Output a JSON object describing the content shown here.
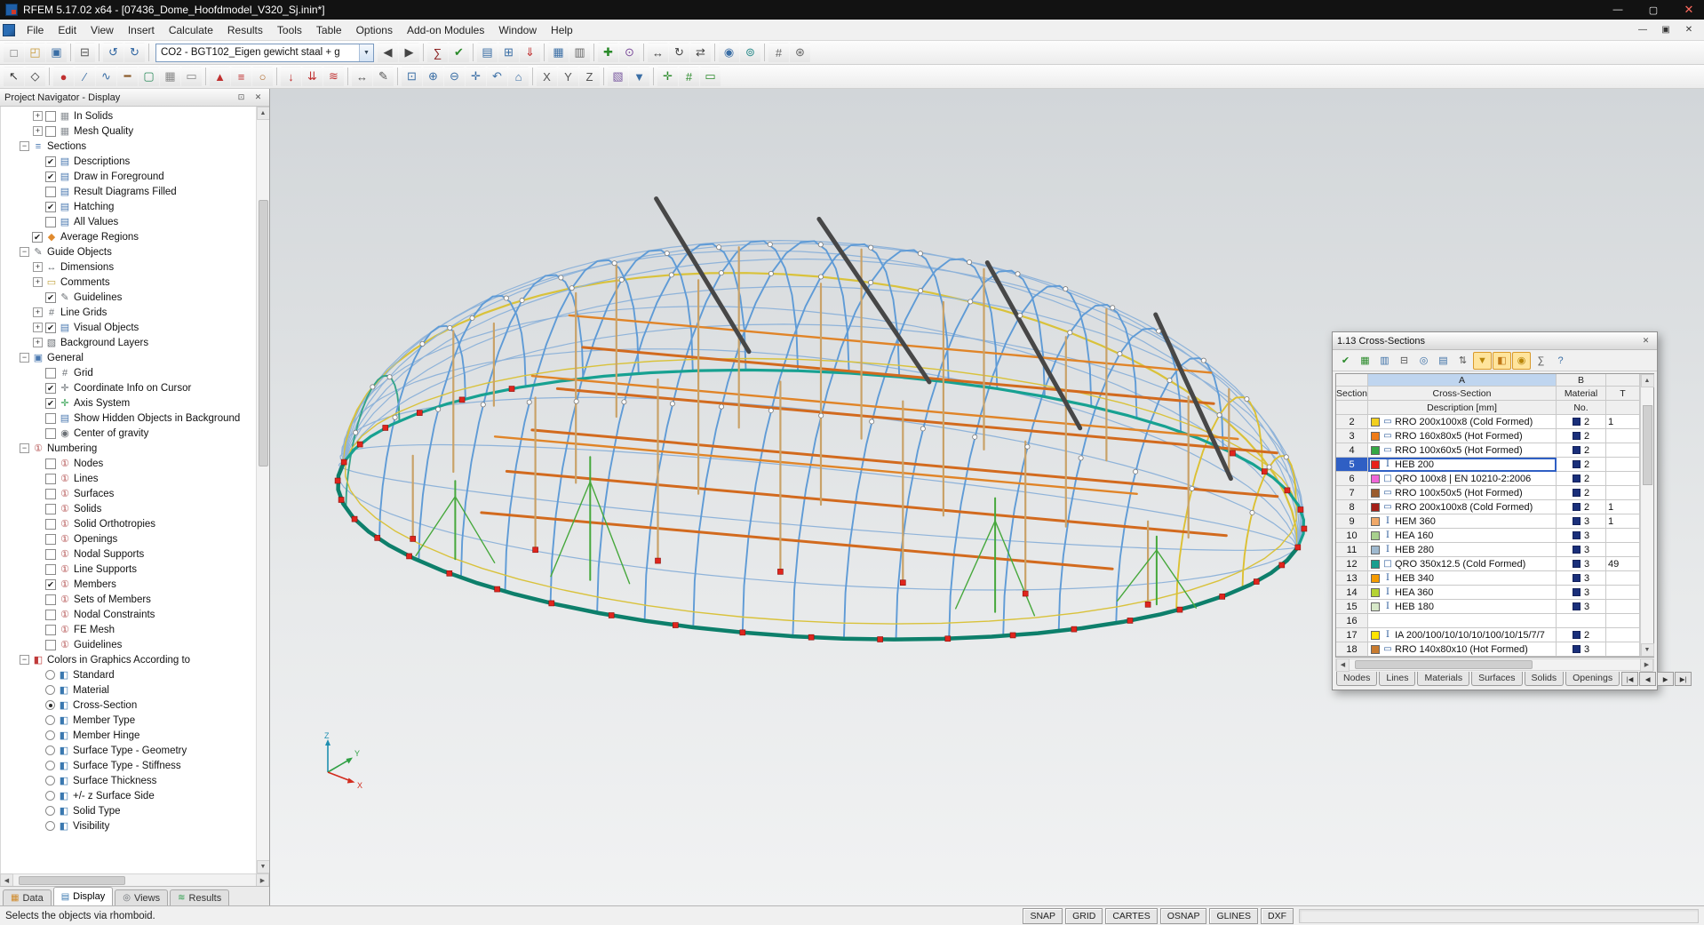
{
  "window": {
    "title": "RFEM 5.17.02 x64 - [07436_Dome_Hoofdmodel_V320_Sj.inin*]",
    "controls": {
      "minimize": "—",
      "maximize": "▢",
      "close": "✕"
    }
  },
  "menubar": {
    "items": [
      "File",
      "Edit",
      "View",
      "Insert",
      "Calculate",
      "Results",
      "Tools",
      "Table",
      "Options",
      "Add-on Modules",
      "Window",
      "Help"
    ],
    "child_controls": {
      "minimize": "—",
      "restore": "▣",
      "close": "✕"
    }
  },
  "toolbar1": {
    "load_case_combo": "CO2 - BGT102_Eigen gewicht staal + g",
    "combo_arrow": "▼",
    "icons_left": [
      {
        "n": "new",
        "g": "□",
        "c": "#666666"
      },
      {
        "n": "open",
        "g": "◰",
        "c": "#c79a3a"
      },
      {
        "n": "save",
        "g": "▣",
        "c": "#3a6ea5"
      },
      {
        "sep": 1
      },
      {
        "n": "print",
        "g": "⊟",
        "c": "#555555"
      },
      {
        "sep": 1
      },
      {
        "n": "undo",
        "g": "↺",
        "c": "#2e64a0"
      },
      {
        "n": "redo",
        "g": "↻",
        "c": "#2e64a0"
      },
      {
        "sep": 1
      }
    ],
    "icons_right": [
      {
        "n": "previous-load-case",
        "g": "◀",
        "c": "#444444"
      },
      {
        "n": "next-load-case",
        "g": "▶",
        "c": "#444444"
      },
      {
        "sep": 1
      },
      {
        "n": "calculation",
        "g": "∑",
        "c": "#8a2020"
      },
      {
        "n": "check-data",
        "g": "✔",
        "c": "#2a8a2a"
      },
      {
        "sep": 1
      },
      {
        "n": "load-cases",
        "g": "▤",
        "c": "#3a6ea5"
      },
      {
        "n": "load-combinations",
        "g": "⊞",
        "c": "#3a6ea5"
      },
      {
        "n": "loads",
        "g": "⇓",
        "c": "#c03030"
      },
      {
        "sep": 1
      },
      {
        "n": "tables",
        "g": "▦",
        "c": "#3a6ea5"
      },
      {
        "n": "printout-report",
        "g": "▥",
        "c": "#666666"
      },
      {
        "sep": 1
      },
      {
        "n": "add-module",
        "g": "✚",
        "c": "#2a8a2a"
      },
      {
        "n": "modules",
        "g": "⊙",
        "c": "#7a4a9a"
      },
      {
        "sep": 1
      },
      {
        "n": "move",
        "g": "↔",
        "c": "#444444"
      },
      {
        "n": "rotate",
        "g": "↻",
        "c": "#444444"
      },
      {
        "n": "mirror",
        "g": "⇄",
        "c": "#444444"
      },
      {
        "sep": 1
      },
      {
        "n": "visibility",
        "g": "◉",
        "c": "#3a6ea5"
      },
      {
        "n": "user-views",
        "g": "⊚",
        "c": "#2a8a8a"
      },
      {
        "sep": 1
      },
      {
        "n": "generate-mesh",
        "g": "#",
        "c": "#666666"
      },
      {
        "n": "settings",
        "g": "⊛",
        "c": "#666666"
      }
    ]
  },
  "toolbar2": {
    "icons": [
      {
        "n": "select-pointer",
        "g": "↖",
        "c": "#333333"
      },
      {
        "n": "select-rhomboid",
        "g": "◇",
        "c": "#333333"
      },
      {
        "sep": 1
      },
      {
        "n": "node",
        "g": "●",
        "c": "#c03030"
      },
      {
        "n": "line",
        "g": "∕",
        "c": "#3a6ea5"
      },
      {
        "n": "arc",
        "g": "∿",
        "c": "#3a6ea5"
      },
      {
        "n": "member",
        "g": "━",
        "c": "#8a5a2a"
      },
      {
        "n": "surface",
        "g": "▢",
        "c": "#2a8a5a"
      },
      {
        "n": "solid",
        "g": "▦",
        "c": "#888888"
      },
      {
        "n": "opening",
        "g": "▭",
        "c": "#888888"
      },
      {
        "sep": 1
      },
      {
        "n": "nodal-support",
        "g": "▲",
        "c": "#c03030"
      },
      {
        "n": "line-support",
        "g": "≡",
        "c": "#c03030"
      },
      {
        "n": "member-hinge",
        "g": "○",
        "c": "#b06a2a"
      },
      {
        "sep": 1
      },
      {
        "n": "nodal-load",
        "g": "↓",
        "c": "#c03030"
      },
      {
        "n": "line-load",
        "g": "⇊",
        "c": "#c03030"
      },
      {
        "n": "surface-load",
        "g": "≋",
        "c": "#c03030"
      },
      {
        "sep": 1
      },
      {
        "n": "dimension",
        "g": "↔",
        "c": "#555555"
      },
      {
        "n": "comment",
        "g": "✎",
        "c": "#555555"
      },
      {
        "sep": 1
      },
      {
        "n": "zoom-window",
        "g": "⊡",
        "c": "#3a6ea5"
      },
      {
        "n": "zoom-in",
        "g": "⊕",
        "c": "#3a6ea5"
      },
      {
        "n": "zoom-out",
        "g": "⊖",
        "c": "#3a6ea5"
      },
      {
        "n": "pan",
        "g": "✛",
        "c": "#3a6ea5"
      },
      {
        "n": "previous-view",
        "g": "↶",
        "c": "#3a6ea5"
      },
      {
        "n": "isometric-view",
        "g": "⌂",
        "c": "#3a6ea5"
      },
      {
        "sep": 1
      },
      {
        "n": "view-in-x",
        "g": "X",
        "c": "#555555"
      },
      {
        "n": "view-in-y",
        "g": "Y",
        "c": "#555555"
      },
      {
        "n": "view-in-z",
        "g": "Z",
        "c": "#555555"
      },
      {
        "sep": 1
      },
      {
        "n": "clipping-box",
        "g": "▧",
        "c": "#7a5aa0"
      },
      {
        "n": "visibility-filter",
        "g": "▼",
        "c": "#3a6ea5"
      },
      {
        "sep": 1
      },
      {
        "n": "snap-toggle",
        "g": "✛",
        "c": "#2a8a2a"
      },
      {
        "n": "grid-toggle",
        "g": "#",
        "c": "#2a8a2a"
      },
      {
        "n": "work-plane",
        "g": "▭",
        "c": "#2a8a2a"
      }
    ]
  },
  "navigator": {
    "title": "Project Navigator - Display",
    "header_icons": {
      "pin": "⊡",
      "close": "✕"
    },
    "tree": [
      {
        "l": "In Solids",
        "ind": 2,
        "exp": "+",
        "ctl": "c",
        "on": false,
        "ic": "mesh-icon"
      },
      {
        "l": "Mesh Quality",
        "ind": 2,
        "exp": "+",
        "ctl": "c",
        "on": false,
        "ic": "mesh-icon"
      },
      {
        "l": "Sections",
        "ind": 1,
        "exp": "-",
        "ctl": "",
        "on": false,
        "ic": "sections-icon"
      },
      {
        "l": "Descriptions",
        "ind": 2,
        "exp": "",
        "ctl": "c",
        "on": true,
        "ic": "display-icon"
      },
      {
        "l": "Draw in Foreground",
        "ind": 2,
        "exp": "",
        "ctl": "c",
        "on": true,
        "ic": "display-icon"
      },
      {
        "l": "Result Diagrams Filled",
        "ind": 2,
        "exp": "",
        "ctl": "c",
        "on": false,
        "ic": "display-icon"
      },
      {
        "l": "Hatching",
        "ind": 2,
        "exp": "",
        "ctl": "c",
        "on": true,
        "ic": "display-icon"
      },
      {
        "l": "All Values",
        "ind": 2,
        "exp": "",
        "ctl": "c",
        "on": false,
        "ic": "display-icon"
      },
      {
        "l": "Average Regions",
        "ind": 1,
        "exp": "",
        "ctl": "c",
        "on": true,
        "ic": "region-icon"
      },
      {
        "l": "Guide Objects",
        "ind": 1,
        "exp": "-",
        "ctl": "",
        "on": false,
        "ic": "guide-icon"
      },
      {
        "l": "Dimensions",
        "ind": 2,
        "exp": "+",
        "ctl": "",
        "on": false,
        "ic": "dimension-tree-icon"
      },
      {
        "l": "Comments",
        "ind": 2,
        "exp": "+",
        "ctl": "",
        "on": false,
        "ic": "comment-tree-icon"
      },
      {
        "l": "Guidelines",
        "ind": 2,
        "exp": "",
        "ctl": "c",
        "on": true,
        "ic": "guide-icon"
      },
      {
        "l": "Line Grids",
        "ind": 2,
        "exp": "+",
        "ctl": "",
        "on": false,
        "ic": "grid-tree-icon"
      },
      {
        "l": "Visual Objects",
        "ind": 2,
        "exp": "+",
        "ctl": "c",
        "on": true,
        "ic": "display-icon"
      },
      {
        "l": "Background Layers",
        "ind": 2,
        "exp": "+",
        "ctl": "",
        "on": false,
        "ic": "layers-icon"
      },
      {
        "l": "General",
        "ind": 1,
        "exp": "-",
        "ctl": "",
        "on": false,
        "ic": "general-icon"
      },
      {
        "l": "Grid",
        "ind": 2,
        "exp": "",
        "ctl": "c",
        "on": false,
        "ic": "grid-tree-icon"
      },
      {
        "l": "Coordinate Info on Cursor",
        "ind": 2,
        "exp": "",
        "ctl": "c",
        "on": true,
        "ic": "cursor-icon"
      },
      {
        "l": "Axis System",
        "ind": 2,
        "exp": "",
        "ctl": "c",
        "on": true,
        "ic": "axis-icon"
      },
      {
        "l": "Show Hidden Objects in Background",
        "ind": 2,
        "exp": "",
        "ctl": "c",
        "on": false,
        "ic": "display-icon"
      },
      {
        "l": "Center of gravity",
        "ind": 2,
        "exp": "",
        "ctl": "c",
        "on": false,
        "ic": "gravity-icon"
      },
      {
        "l": "Numbering",
        "ind": 1,
        "exp": "-",
        "ctl": "",
        "on": false,
        "ic": "numbering-icon"
      },
      {
        "l": "Nodes",
        "ind": 2,
        "exp": "",
        "ctl": "c",
        "on": false,
        "ic": "numbering-icon"
      },
      {
        "l": "Lines",
        "ind": 2,
        "exp": "",
        "ctl": "c",
        "on": false,
        "ic": "numbering-icon"
      },
      {
        "l": "Surfaces",
        "ind": 2,
        "exp": "",
        "ctl": "c",
        "on": false,
        "ic": "numbering-icon"
      },
      {
        "l": "Solids",
        "ind": 2,
        "exp": "",
        "ctl": "c",
        "on": false,
        "ic": "numbering-icon"
      },
      {
        "l": "Solid Orthotropies",
        "ind": 2,
        "exp": "",
        "ctl": "c",
        "on": false,
        "ic": "numbering-icon"
      },
      {
        "l": "Openings",
        "ind": 2,
        "exp": "",
        "ctl": "c",
        "on": false,
        "ic": "numbering-icon"
      },
      {
        "l": "Nodal Supports",
        "ind": 2,
        "exp": "",
        "ctl": "c",
        "on": false,
        "ic": "numbering-icon"
      },
      {
        "l": "Line Supports",
        "ind": 2,
        "exp": "",
        "ctl": "c",
        "on": false,
        "ic": "numbering-icon"
      },
      {
        "l": "Members",
        "ind": 2,
        "exp": "",
        "ctl": "c",
        "on": true,
        "ic": "numbering-icon"
      },
      {
        "l": "Sets of Members",
        "ind": 2,
        "exp": "",
        "ctl": "c",
        "on": false,
        "ic": "numbering-icon"
      },
      {
        "l": "Nodal Constraints",
        "ind": 2,
        "exp": "",
        "ctl": "c",
        "on": false,
        "ic": "numbering-icon"
      },
      {
        "l": "FE Mesh",
        "ind": 2,
        "exp": "",
        "ctl": "c",
        "on": false,
        "ic": "numbering-icon"
      },
      {
        "l": "Guidelines",
        "ind": 2,
        "exp": "",
        "ctl": "c",
        "on": false,
        "ic": "numbering-icon"
      },
      {
        "l": "Colors in Graphics According to",
        "ind": 1,
        "exp": "-",
        "ctl": "",
        "on": false,
        "ic": "colors-icon"
      },
      {
        "l": "Standard",
        "ind": 2,
        "exp": "",
        "ctl": "r",
        "on": false,
        "ic": "palette-icon"
      },
      {
        "l": "Material",
        "ind": 2,
        "exp": "",
        "ctl": "r",
        "on": false,
        "ic": "palette-icon"
      },
      {
        "l": "Cross-Section",
        "ind": 2,
        "exp": "",
        "ctl": "r",
        "on": true,
        "ic": "palette-icon"
      },
      {
        "l": "Member Type",
        "ind": 2,
        "exp": "",
        "ctl": "r",
        "on": false,
        "ic": "palette-icon"
      },
      {
        "l": "Member Hinge",
        "ind": 2,
        "exp": "",
        "ctl": "r",
        "on": false,
        "ic": "palette-icon"
      },
      {
        "l": "Surface Type - Geometry",
        "ind": 2,
        "exp": "",
        "ctl": "r",
        "on": false,
        "ic": "palette-icon"
      },
      {
        "l": "Surface Type - Stiffness",
        "ind": 2,
        "exp": "",
        "ctl": "r",
        "on": false,
        "ic": "palette-icon"
      },
      {
        "l": "Surface Thickness",
        "ind": 2,
        "exp": "",
        "ctl": "r",
        "on": false,
        "ic": "palette-icon"
      },
      {
        "l": "+/- z Surface Side",
        "ind": 2,
        "exp": "",
        "ctl": "r",
        "on": false,
        "ic": "palette-icon"
      },
      {
        "l": "Solid Type",
        "ind": 2,
        "exp": "",
        "ctl": "r",
        "on": false,
        "ic": "palette-icon"
      },
      {
        "l": "Visibility",
        "ind": 2,
        "exp": "",
        "ctl": "r",
        "on": false,
        "ic": "palette-icon"
      }
    ],
    "tabs": [
      {
        "label": "Data",
        "icon_glyph": "▦",
        "icon_color": "#d08a2a",
        "icon": "data-tab-icon",
        "active": false
      },
      {
        "label": "Display",
        "icon_glyph": "▤",
        "icon_color": "#3a78b0",
        "icon": "display-tab-icon",
        "active": true
      },
      {
        "label": "Views",
        "icon_glyph": "◎",
        "icon_color": "#6a6f74",
        "icon": "views-tab-icon",
        "active": false
      },
      {
        "label": "Results",
        "icon_glyph": "≋",
        "icon_color": "#2a9d4a",
        "icon": "results-tab-icon",
        "active": false
      }
    ]
  },
  "canvas": {
    "axis": {
      "x": "X",
      "y": "Y",
      "z": "Z"
    }
  },
  "cross_sections_panel": {
    "title": "1.13 Cross-Sections",
    "close_icon": "✕",
    "toolbar": [
      {
        "n": "apply",
        "g": "✔",
        "c": "#2a8a2a"
      },
      {
        "n": "excel-export",
        "g": "▦",
        "c": "#2a8a2a"
      },
      {
        "n": "import-table",
        "g": "▥",
        "c": "#3a6ea5"
      },
      {
        "n": "print-table",
        "g": "⊟",
        "c": "#555555"
      },
      {
        "n": "find",
        "g": "◎",
        "c": "#3a6ea5"
      },
      {
        "n": "view-mode",
        "g": "▤",
        "c": "#3a6ea5"
      },
      {
        "n": "sort",
        "g": "⇅",
        "c": "#555555"
      },
      {
        "n": "filter",
        "g": "▼",
        "c": "#b8860b",
        "pressed": true
      },
      {
        "n": "color-reference",
        "g": "◧",
        "c": "#c07818",
        "pressed": true
      },
      {
        "n": "highlight-selection",
        "g": "◉",
        "c": "#b8860b",
        "pressed": true
      },
      {
        "n": "calculator",
        "g": "∑",
        "c": "#555555"
      },
      {
        "n": "help",
        "g": "?",
        "c": "#3a6ea5"
      }
    ],
    "col_group": {
      "a": "A",
      "b": "B"
    },
    "headers": {
      "col1_line1": "Section",
      "col1_line2": "",
      "col2_line1": "Cross-Section",
      "col2_line2": "Description [mm]",
      "col3_line1": "Material",
      "col3_line2": "No.",
      "col4_line1": "T",
      "col4_line2": ""
    },
    "rows": [
      {
        "no": "2",
        "color": "#f2cf1d",
        "shape": "▭",
        "desc": "RRO 200x100x8 (Cold Formed)",
        "mat": "2",
        "extra": "1",
        "selected": false
      },
      {
        "no": "3",
        "color": "#f07c18",
        "shape": "▭",
        "desc": "RRO 160x80x5 (Hot Formed)",
        "mat": "2",
        "extra": "",
        "selected": false
      },
      {
        "no": "4",
        "color": "#35a845",
        "shape": "▭",
        "desc": "RRO 100x60x5 (Hot Formed)",
        "mat": "2",
        "extra": "",
        "selected": false
      },
      {
        "no": "5",
        "color": "#e8231a",
        "shape": "I",
        "desc": "HEB 200",
        "mat": "2",
        "extra": "",
        "selected": true
      },
      {
        "no": "6",
        "color": "#ef66d8",
        "shape": "□",
        "desc": "QRO 100x8 | EN 10210-2:2006",
        "mat": "2",
        "extra": "",
        "selected": false
      },
      {
        "no": "7",
        "color": "#9a5b2d",
        "shape": "▭",
        "desc": "RRO 100x50x5 (Hot Formed)",
        "mat": "2",
        "extra": "",
        "selected": false
      },
      {
        "no": "8",
        "color": "#a52019",
        "shape": "▭",
        "desc": "RRO 200x100x8 (Cold Formed)",
        "mat": "2",
        "extra": "1",
        "selected": false
      },
      {
        "no": "9",
        "color": "#f0a868",
        "shape": "I",
        "desc": "HEM 360",
        "mat": "3",
        "extra": "1",
        "selected": false
      },
      {
        "no": "10",
        "color": "#a8d08d",
        "shape": "I",
        "desc": "HEA 160",
        "mat": "3",
        "extra": "",
        "selected": false
      },
      {
        "no": "11",
        "color": "#9fb9cf",
        "shape": "I",
        "desc": "HEB 280",
        "mat": "3",
        "extra": "",
        "selected": false
      },
      {
        "no": "12",
        "color": "#1a9e8f",
        "shape": "□",
        "desc": "QRO 350x12.5 (Cold Formed)",
        "mat": "3",
        "extra": "49",
        "selected": false
      },
      {
        "no": "13",
        "color": "#f59b00",
        "shape": "I",
        "desc": "HEB 340",
        "mat": "3",
        "extra": "",
        "selected": false
      },
      {
        "no": "14",
        "color": "#b5d334",
        "shape": "I",
        "desc": "HEA 360",
        "mat": "3",
        "extra": "",
        "selected": false
      },
      {
        "no": "15",
        "color": "#d7e8c8",
        "shape": "I",
        "desc": "HEB 180",
        "mat": "3",
        "extra": "",
        "selected": false
      },
      {
        "no": "16",
        "color": "",
        "shape": "",
        "desc": "",
        "mat": "",
        "extra": "",
        "selected": false
      },
      {
        "no": "17",
        "color": "#ffe500",
        "shape": "I",
        "desc": "IA 200/100/10/10/10/100/10/15/7/7",
        "mat": "2",
        "extra": "",
        "selected": false
      },
      {
        "no": "18",
        "color": "#c87b2f",
        "shape": "▭",
        "desc": "RRO 140x80x10 (Hot Formed)",
        "mat": "3",
        "extra": "",
        "selected": false
      }
    ],
    "tabs": [
      "Nodes",
      "Lines",
      "Materials",
      "Surfaces",
      "Solids",
      "Openings"
    ],
    "nav_buttons": [
      "|◀",
      "◀",
      "▶",
      "▶|"
    ]
  },
  "statusbar": {
    "message": "Selects the objects via rhomboid.",
    "toggles": [
      "SNAP",
      "GRID",
      "CARTES",
      "OSNAP",
      "GLINES",
      "DXF"
    ]
  }
}
